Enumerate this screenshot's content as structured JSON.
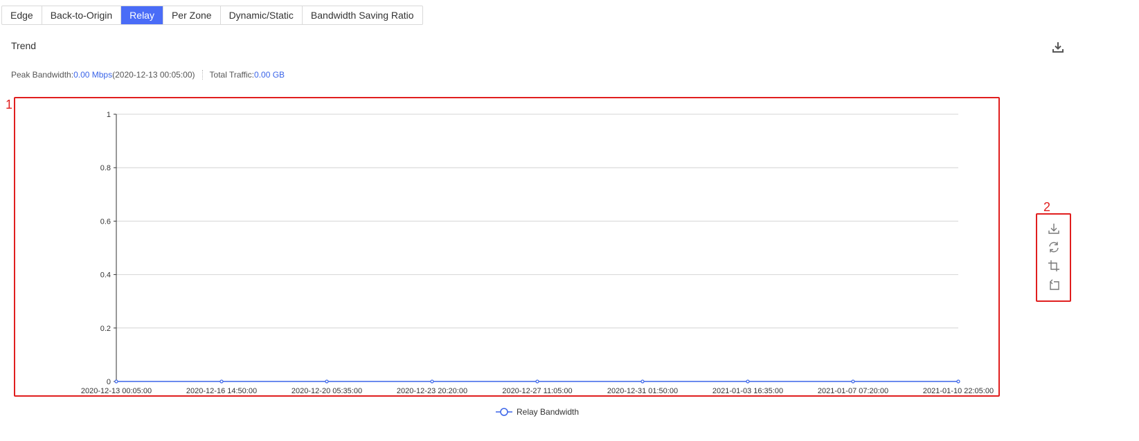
{
  "tabs": [
    {
      "label": "Edge"
    },
    {
      "label": "Back-to-Origin"
    },
    {
      "label": "Relay",
      "active": true
    },
    {
      "label": "Per Zone"
    },
    {
      "label": "Dynamic/Static"
    },
    {
      "label": "Bandwidth Saving Ratio"
    }
  ],
  "section_title": "Trend",
  "stats": {
    "peak_label": "Peak Bandwidth: ",
    "peak_value": "0.00 Mbps",
    "peak_time": "(2020-12-13 00:05:00)",
    "traffic_label": "Total Traffic: ",
    "traffic_value": "0.00 GB"
  },
  "annotations": {
    "box1": "1",
    "box2": "2"
  },
  "icons": {
    "top_download": "download-icon",
    "toolbox": [
      "save-image-icon",
      "restore-icon",
      "zoom-icon",
      "zoom-reset-icon"
    ]
  },
  "colors": {
    "accent": "#4a6cf7",
    "series": "#3a64e8",
    "annotation": "#e01e1e"
  },
  "chart_data": {
    "type": "line",
    "title": "",
    "xlabel": "",
    "ylabel": "",
    "ylim": [
      0,
      1
    ],
    "yticks": [
      "0",
      "0.2",
      "0.4",
      "0.6",
      "0.8",
      "1"
    ],
    "x": [
      "2020-12-13 00:05:00",
      "2020-12-16 14:50:00",
      "2020-12-20 05:35:00",
      "2020-12-23 20:20:00",
      "2020-12-27 11:05:00",
      "2020-12-31 01:50:00",
      "2021-01-03 16:35:00",
      "2021-01-07 07:20:00",
      "2021-01-10 22:05:00"
    ],
    "series": [
      {
        "name": "Relay Bandwidth",
        "values": [
          0,
          0,
          0,
          0,
          0,
          0,
          0,
          0,
          0
        ]
      }
    ],
    "grid": true,
    "legend": "bottom-center"
  }
}
